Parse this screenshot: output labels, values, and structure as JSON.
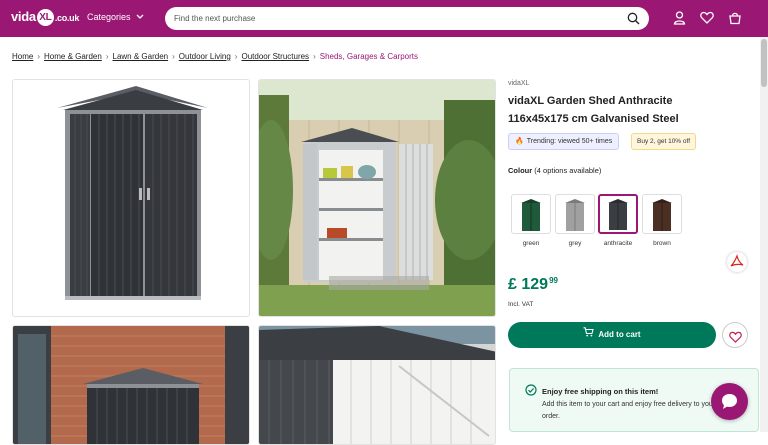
{
  "header": {
    "logo_text": "vida",
    "logo_mark": "XL",
    "logo_domain": ".co.uk",
    "categories_label": "Categories",
    "search_placeholder": "Find the next purchase",
    "icons": [
      "search-icon",
      "user-icon",
      "heart-icon",
      "basket-icon"
    ]
  },
  "breadcrumbs": [
    {
      "label": "Home"
    },
    {
      "label": "Home & Garden"
    },
    {
      "label": "Lawn & Garden"
    },
    {
      "label": "Outdoor Living"
    },
    {
      "label": "Outdoor Structures"
    },
    {
      "label": "Sheds, Garages & Carports"
    }
  ],
  "gallery": {
    "images": [
      "shed-front",
      "shed-garden-open",
      "shed-brick-wall",
      "shed-detail"
    ]
  },
  "product": {
    "brand": "vidaXL",
    "title": "vidaXL Garden Shed Anthracite 116x45x175 cm Galvanised Steel",
    "trending": "Trending: viewed 50+ times",
    "promo": "Buy 2, get 10% off",
    "colour_label": "Colour",
    "colour_note": "(4 options available)",
    "colours": [
      {
        "label": "green",
        "color": "#1f5a3a"
      },
      {
        "label": "grey",
        "color": "#9a9a9a"
      },
      {
        "label": "anthracite",
        "color": "#3a3d42"
      },
      {
        "label": "brown",
        "color": "#4a2f22"
      }
    ],
    "selected_colour": "anthracite",
    "price_currency": "£",
    "price_main": "129",
    "price_cents": "99",
    "vat": "Incl. VAT",
    "add_to_cart": "Add to cart"
  },
  "shipping": {
    "title": "Enjoy free shipping on this item!",
    "text": "Add this item to your cart and enjoy free delivery to your order."
  },
  "colors": {
    "brand": "#9a1873",
    "accent_green": "#00785a"
  }
}
